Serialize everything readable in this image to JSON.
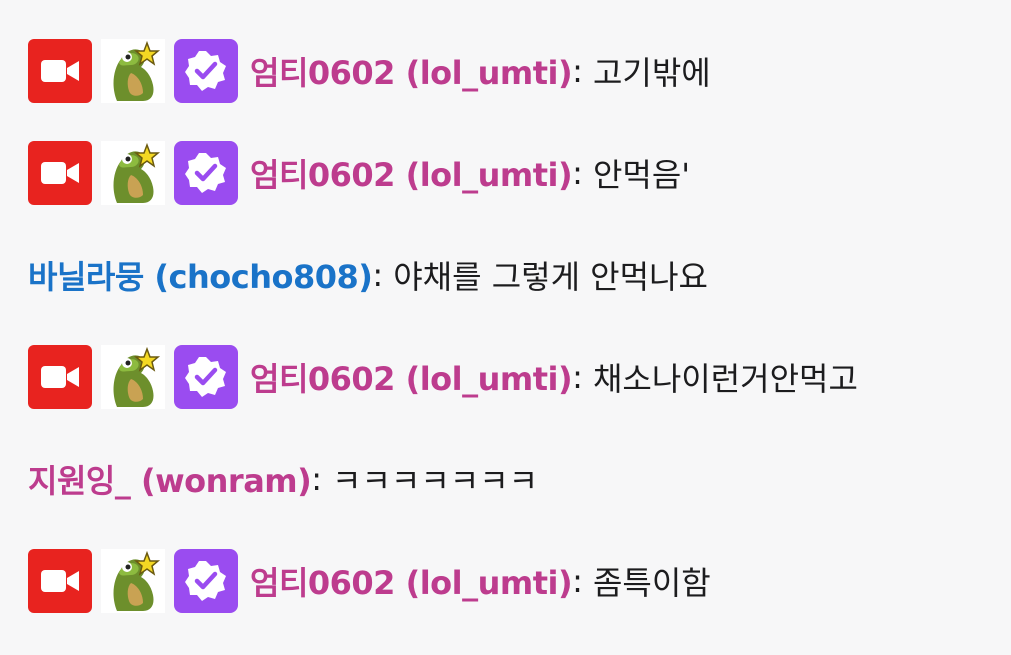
{
  "colors": {
    "background": "#f7f7f8",
    "live_badge": "#e8231f",
    "verified_badge": "#9a4cf0",
    "umti_name": "#bd3c8e",
    "blue_name": "#1a73c8",
    "pink_name": "#bd3c8e",
    "message_text": "#1c1c1e"
  },
  "icons": {
    "live": "video-camera-icon",
    "subscriber": "frog-star-icon",
    "verified": "verified-check-icon"
  },
  "messages": [
    {
      "display_name": "엄티0602 (lol_umti)",
      "separator": ":",
      "text": "고기밖에"
    },
    {
      "display_name": "엄티0602 (lol_umti)",
      "separator": ":",
      "text": "안먹음'"
    },
    {
      "display_name": "바닐라뭉 (chocho808)",
      "separator": ":",
      "text": "야채를 그렇게 안먹나요"
    },
    {
      "display_name": "엄티0602 (lol_umti)",
      "separator": ":",
      "text": "채소나이런거안먹고"
    },
    {
      "display_name": "지원잉_ (wonram)",
      "separator": ":",
      "text": "ㅋㅋㅋㅋㅋㅋㅋ"
    },
    {
      "display_name": "엄티0602 (lol_umti)",
      "separator": ":",
      "text": "좀특이함"
    }
  ]
}
